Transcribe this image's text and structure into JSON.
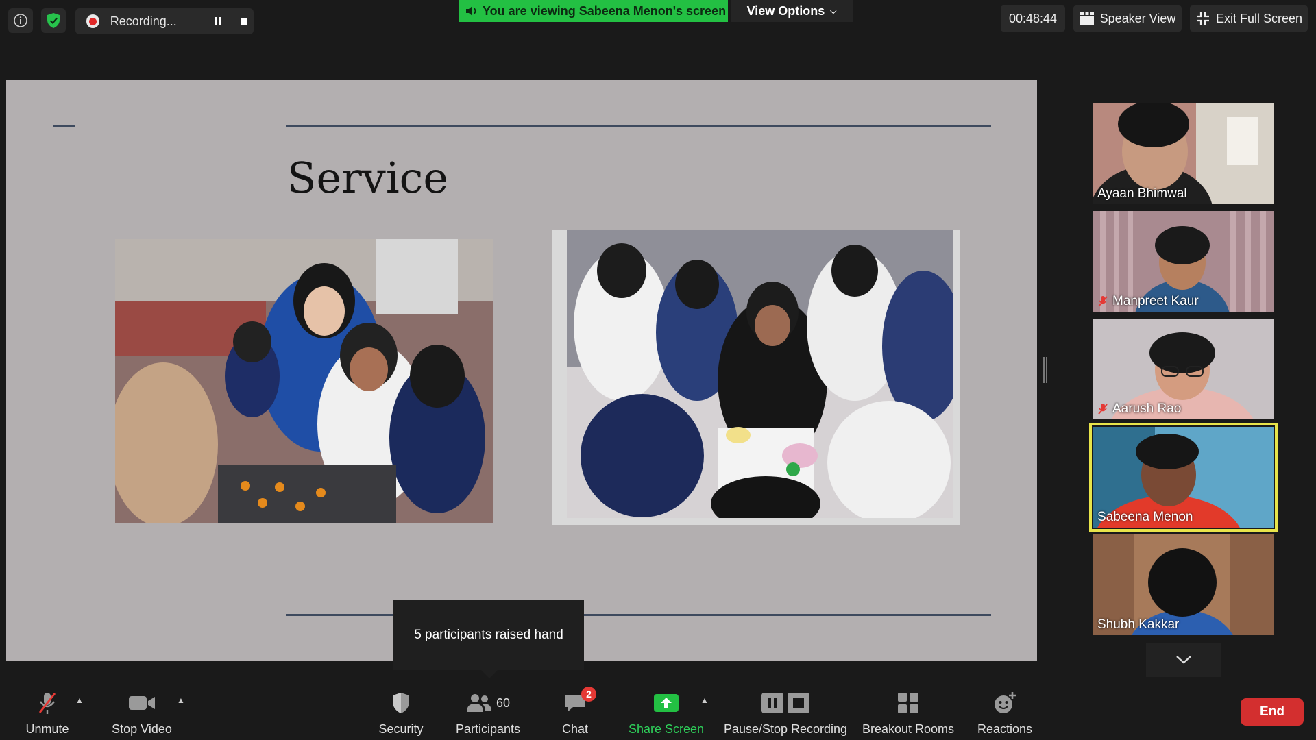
{
  "top_bar": {
    "recording_label": "Recording...",
    "viewing_banner": "You are viewing Sabeena Menon's screen",
    "view_options_label": "View Options",
    "timer": "00:48:44",
    "speaker_view_label": "Speaker View",
    "exit_full_screen_label": "Exit Full Screen"
  },
  "slide": {
    "title": "Service"
  },
  "tooltip": {
    "text": "5 participants raised hand"
  },
  "participants": [
    {
      "name": "Ayaan Bhimwal",
      "muted": false,
      "active": false
    },
    {
      "name": "Manpreet Kaur",
      "muted": true,
      "active": false
    },
    {
      "name": "Aarush Rao",
      "muted": true,
      "active": false
    },
    {
      "name": "Sabeena Menon",
      "muted": false,
      "active": true
    },
    {
      "name": "Shubh Kakkar",
      "muted": false,
      "active": false
    }
  ],
  "toolbar": {
    "unmute_label": "Unmute",
    "stop_video_label": "Stop Video",
    "security_label": "Security",
    "participants_label": "Participants",
    "participants_count": "60",
    "chat_label": "Chat",
    "chat_badge": "2",
    "share_screen_label": "Share Screen",
    "recording_label": "Pause/Stop Recording",
    "breakout_label": "Breakout Rooms",
    "reactions_label": "Reactions",
    "end_label": "End"
  },
  "colors": {
    "banner_green": "#23c043",
    "share_green": "#2ed05a",
    "end_red": "#d32f2f",
    "active_speaker": "#e8e44a",
    "slide_bg": "#b3afb0"
  }
}
